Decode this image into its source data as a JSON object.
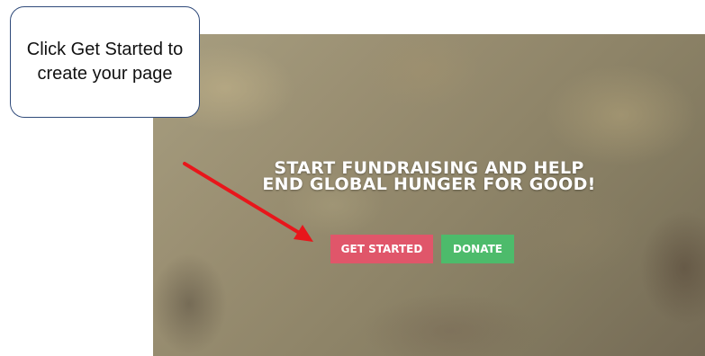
{
  "callout": {
    "text": "Click Get Started to create your page"
  },
  "hero": {
    "title_line1": "START FUNDRAISING AND HELP",
    "title_line2": "END GLOBAL HUNGER FOR GOOD!",
    "get_started_label": "GET STARTED",
    "donate_label": "DONATE"
  },
  "colors": {
    "get_started": "#e0566a",
    "donate": "#4dbb6b",
    "arrow": "#e8161b",
    "callout_border": "#2f4a7a"
  },
  "icons": {
    "pointer": "arrow-icon"
  }
}
